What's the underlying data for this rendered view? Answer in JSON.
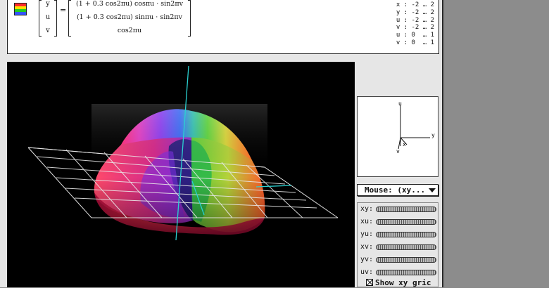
{
  "equation": {
    "lhs": [
      "y",
      "u",
      "v"
    ],
    "equals": "=",
    "rhs": [
      "(1 + 0.3 cos2πu) cosπu · sin2πv",
      "(1 + 0.3 cos2πu) sinπu · sin2πv",
      "cos2πu"
    ]
  },
  "ranges": [
    "x : -2 … 2",
    "y : -2 … 2",
    "u : -2 … 2",
    "v : -2 … 2",
    "u : 0  … 1",
    "v : 0  … 1"
  ],
  "axes_preview": {
    "labels": {
      "up": "u",
      "right": "y",
      "front": "x",
      "down": "v"
    }
  },
  "mouse_mode": {
    "selected": "Mouse: (xy..."
  },
  "rotation_sliders": [
    {
      "label": "xy:"
    },
    {
      "label": "xu:"
    },
    {
      "label": "yu:"
    },
    {
      "label": "xv:"
    },
    {
      "label": "yv:"
    },
    {
      "label": "uv:"
    }
  ],
  "grid_toggle": {
    "label": "Show xy gric",
    "checked": true
  },
  "colors": {
    "background": "#000000",
    "grid": "#e0e0e0",
    "axis": "#2ad1d1"
  }
}
